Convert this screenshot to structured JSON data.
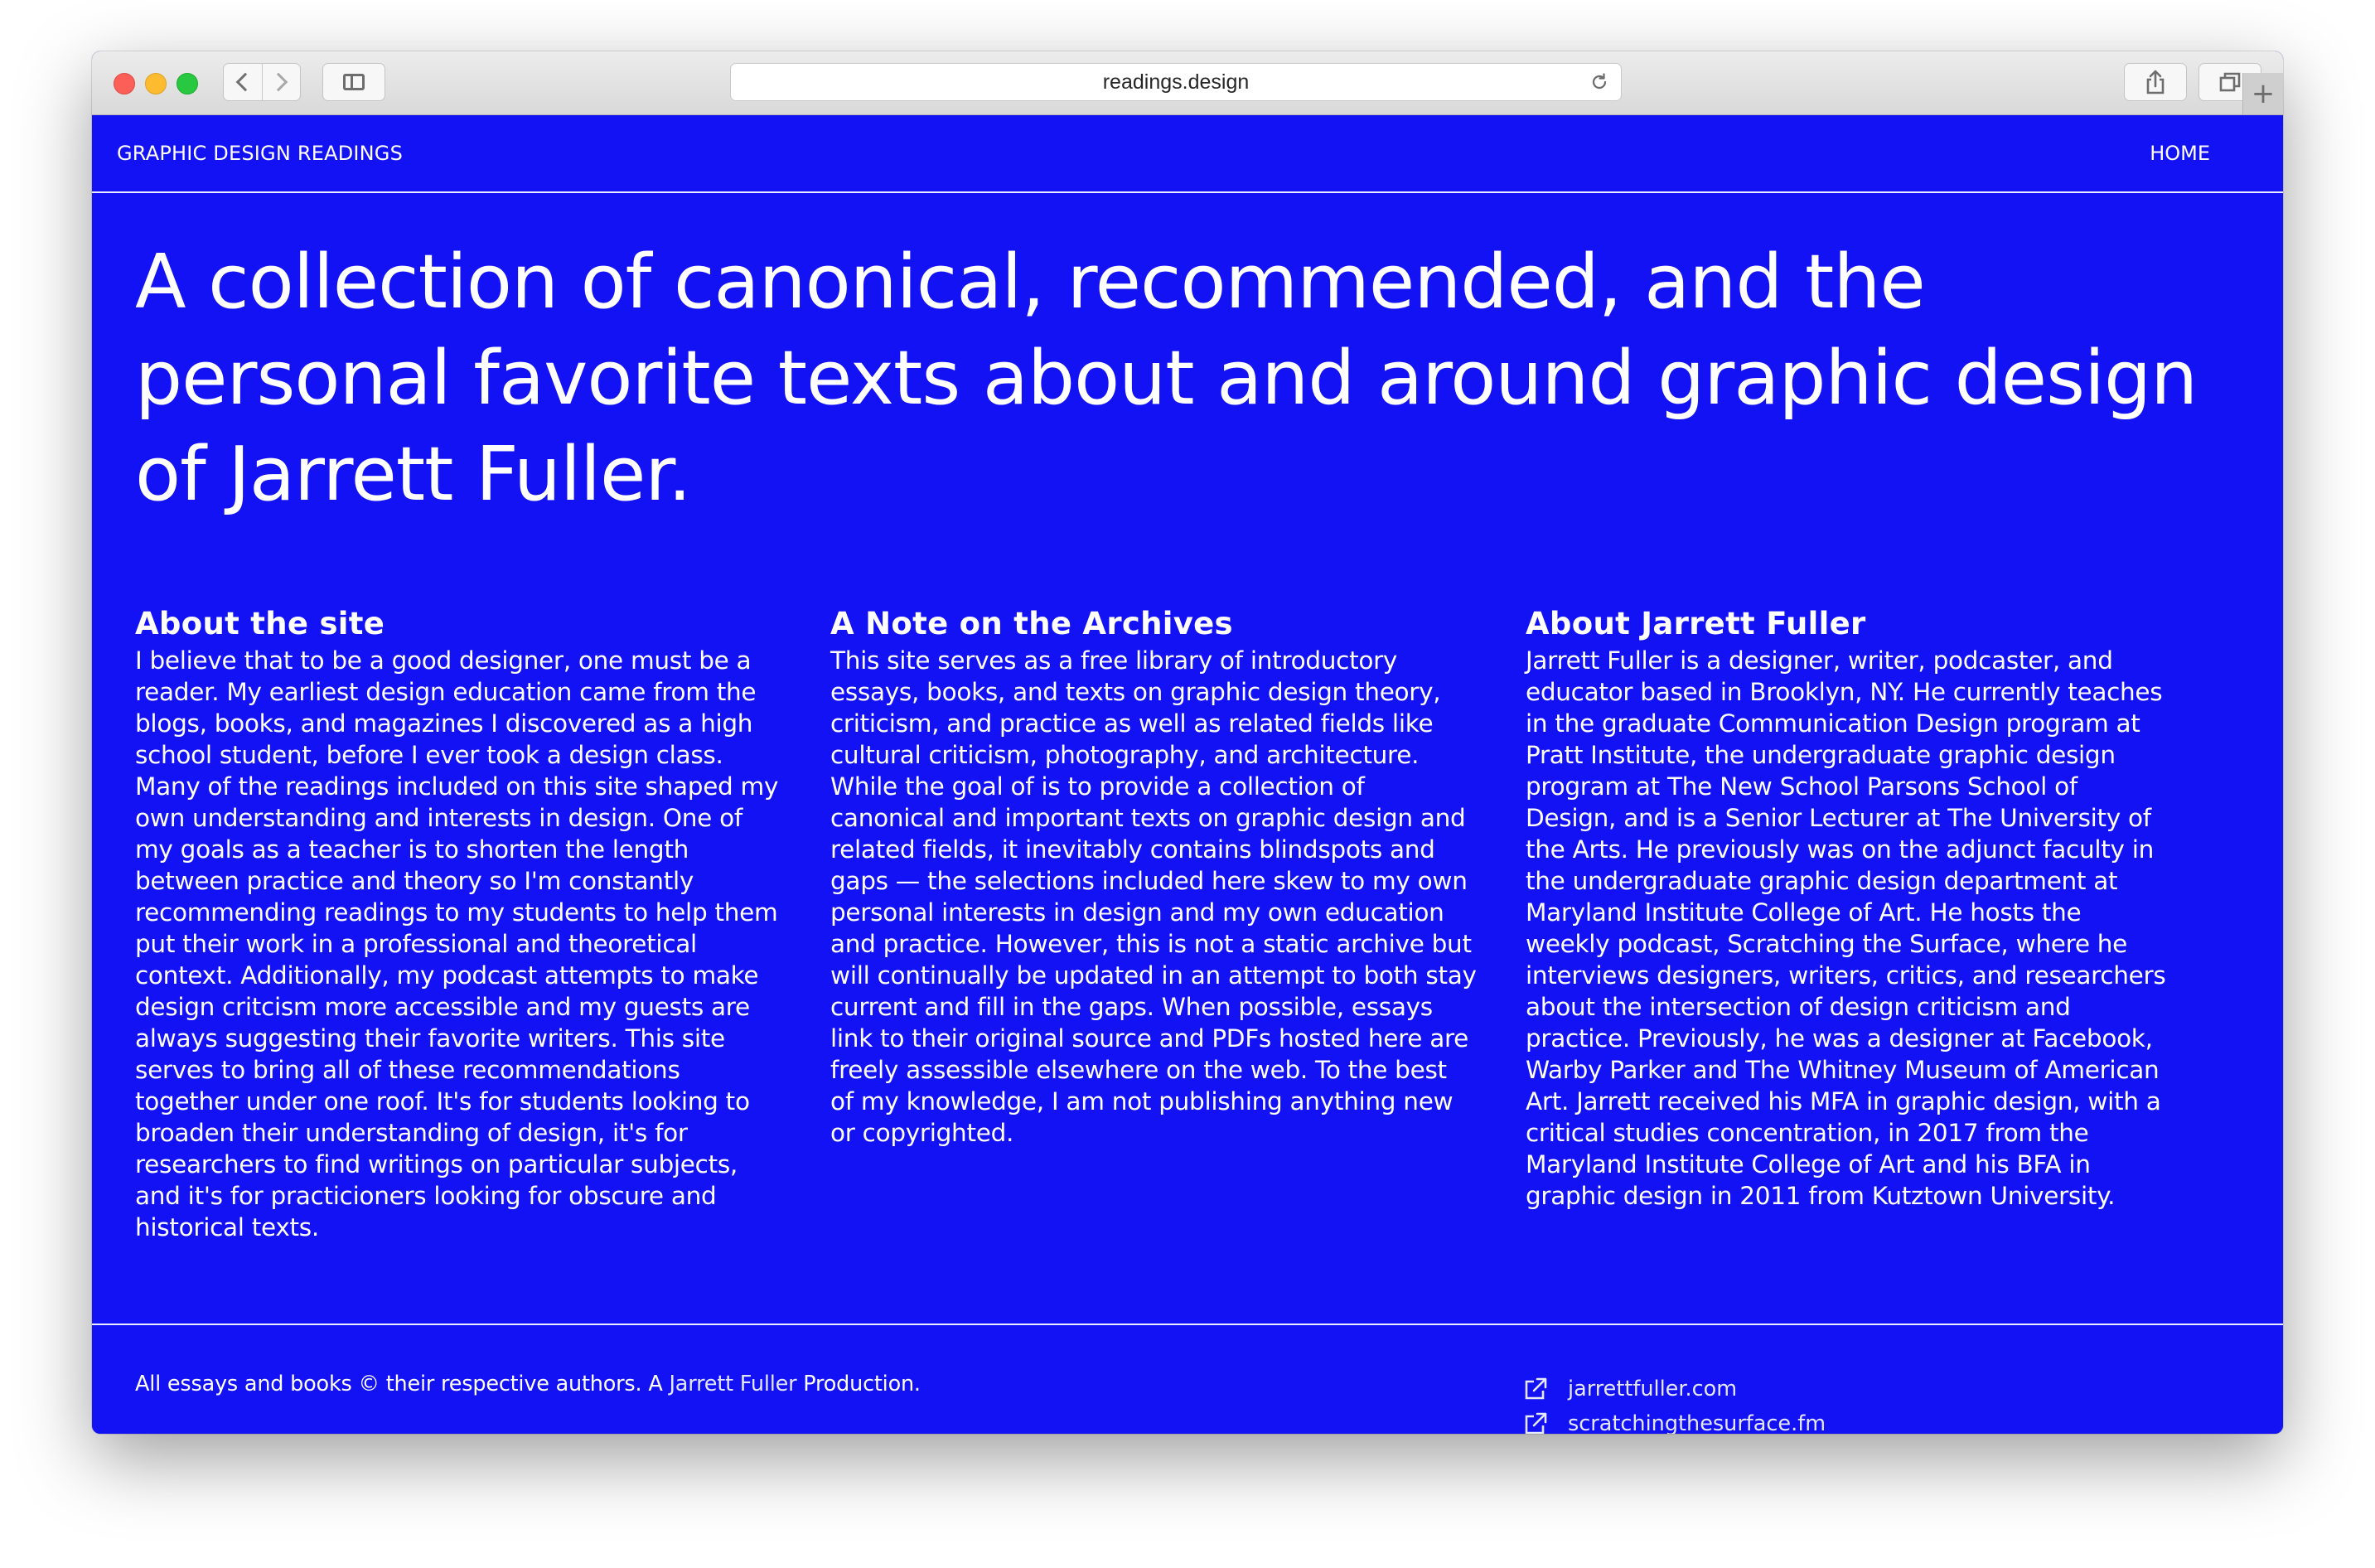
{
  "browser": {
    "url": "readings.design"
  },
  "nav": {
    "brand": "GRAPHIC DESIGN READINGS",
    "home": "HOME"
  },
  "hero": {
    "text": "A collection of canonical, recommended, and the personal favorite texts about and around graphic design of Jarrett Fuller."
  },
  "sections": [
    {
      "title": "About the site",
      "body": "I believe that to be a good designer, one must be a reader. My earliest design education came from the blogs, books, and magazines I discovered as a high school student, before I ever took a design class. Many of the readings included on this site shaped my own understanding and interests in design. One of my goals as a teacher is to shorten the length between practice and theory so I'm constantly recommending readings to my students to help them put their work in a professional and theoretical context. Additionally, my podcast attempts to make design critcism more accessible and my guests are always suggesting their favorite writers. This site serves to bring all of these recommendations together under one roof. It's for students looking to broaden their understanding of design, it's for researchers to find writings on particular subjects, and it's for practicioners looking for obscure and historical texts."
    },
    {
      "title": "A Note on the Archives",
      "body": "This site serves as a free library of introductory essays, books, and texts on graphic design theory, criticism, and practice as well as related fields like cultural criticism, photography, and architecture. While the goal of is to provide a collection of canonical and important texts on graphic design and related fields, it inevitably contains blindspots and gaps — the selections included here skew to my own personal interests in design and my own education and practice. However, this is not a static archive but will continually be updated in an attempt to both stay current and fill in the gaps. When possible, essays link to their original source and PDFs hosted here are freely assessible elsewhere on the web. To the best of my knowledge, I am not publishing anything new or copyrighted."
    },
    {
      "title": "About Jarrett Fuller",
      "body": "Jarrett Fuller is a designer, writer, podcaster, and educator based in Brooklyn, NY. He currently teaches in the graduate Communication Design program at Pratt Institute, the undergraduate graphic design program at The New School Parsons School of Design, and is a Senior Lecturer at The University of the Arts. He previously was on the adjunct faculty in the undergraduate graphic design department at Maryland Institute College of Art. He hosts the weekly podcast, Scratching the Surface, where he interviews designers, writers, critics, and researchers about the intersection of design criticism and practice. Previously, he was a designer at Facebook, Warby Parker and The Whitney Museum of American Art. Jarrett received his MFA in graphic design, with a critical studies concentration, in 2017 from the Maryland Institute College of Art and his BFA in graphic design in 2011 from Kutztown University."
    }
  ],
  "footer": {
    "credit_prefix": "All essays and books © their respective authors. A ",
    "credit_link": "Jarrett Fuller",
    "credit_suffix": " Production.",
    "links": [
      {
        "icon": "external-link-icon",
        "label": "jarrettfuller.com"
      },
      {
        "icon": "external-link-icon",
        "label": "scratchingthesurface.fm"
      }
    ]
  },
  "colors": {
    "page_background": "#1312f4",
    "text": "#ffffff",
    "chrome": "#e4e4e4"
  }
}
